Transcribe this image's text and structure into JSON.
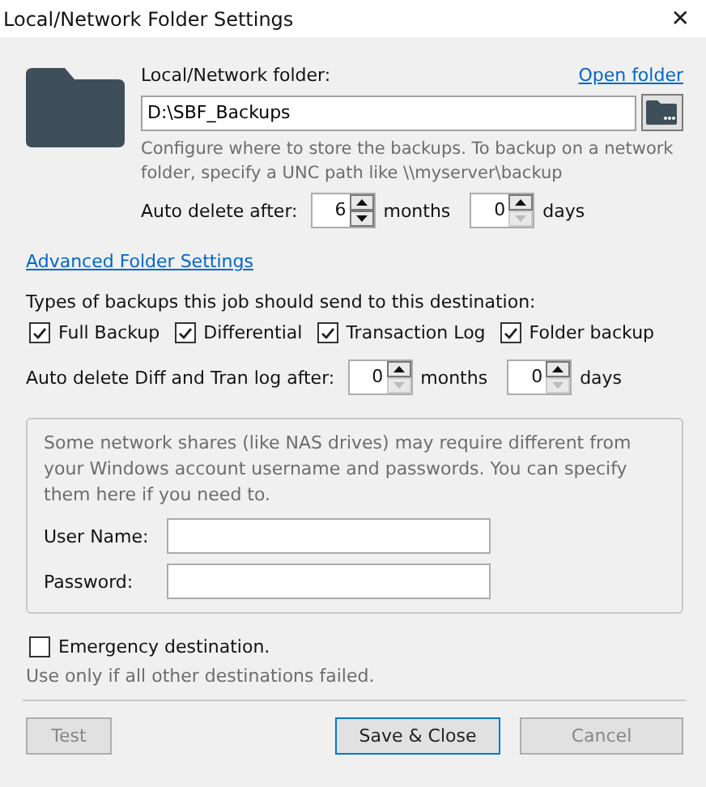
{
  "window": {
    "title": "Local/Network Folder Settings",
    "close": "✕"
  },
  "folder": {
    "label": "Local/Network folder:",
    "open_link": "Open folder",
    "path": "D:\\SBF_Backups",
    "description": "Configure where to store the backups. To backup on a network folder, specify a UNC path like \\\\myserver\\backup"
  },
  "auto_delete": {
    "label": "Auto delete after:",
    "spinners": [
      {
        "value": "6",
        "unit": "months",
        "down_enabled": true
      },
      {
        "value": "0",
        "unit": "days",
        "down_enabled": false
      }
    ]
  },
  "advanced_link": "Advanced Folder Settings",
  "types": {
    "label": "Types of backups this job should send to this destination:",
    "items": [
      {
        "label": "Full Backup",
        "checked": true
      },
      {
        "label": "Differential",
        "checked": true
      },
      {
        "label": "Transaction Log",
        "checked": true
      },
      {
        "label": "Folder backup",
        "checked": true
      }
    ]
  },
  "auto_delete_diff": {
    "label": "Auto delete Diff and Tran log after:",
    "spinners": [
      {
        "value": "0",
        "unit": "months",
        "down_enabled": false
      },
      {
        "value": "0",
        "unit": "days",
        "down_enabled": false
      }
    ]
  },
  "credentials": {
    "note": "Some network shares (like NAS drives) may require different from your Windows account username and passwords. You can specify them here if you need to.",
    "fields": [
      {
        "label": "User Name:"
      },
      {
        "label": "Password:"
      }
    ]
  },
  "emergency": {
    "label": "Emergency destination.",
    "checked": false,
    "note": "Use only if all other destinations failed."
  },
  "buttons": [
    {
      "label": "Test",
      "kind": "plain"
    },
    {
      "label": "Save & Close",
      "kind": "default"
    },
    {
      "label": "Cancel",
      "kind": "plain"
    }
  ]
}
